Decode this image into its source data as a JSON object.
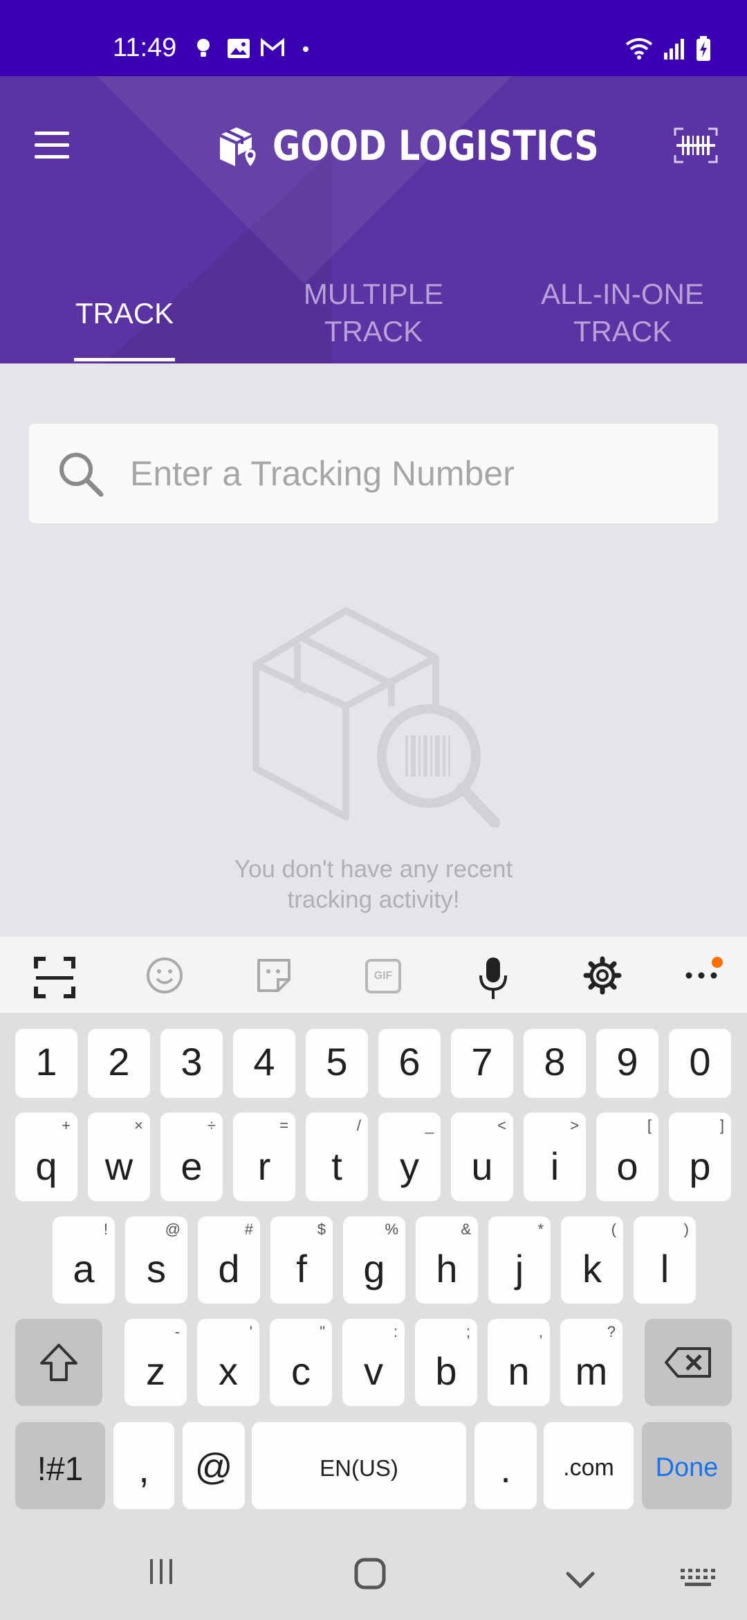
{
  "status_bar": {
    "time": "11:49"
  },
  "app": {
    "title": "GOOD LOGISTICS",
    "tabs": [
      {
        "label": "TRACK",
        "active": true
      },
      {
        "label": "MULTIPLE TRACK",
        "active": false
      },
      {
        "label": "ALL-IN-ONE TRACK",
        "active": false
      }
    ],
    "search": {
      "placeholder": "Enter a Tracking Number",
      "value": ""
    },
    "empty_state": {
      "message": "You don't have any recent tracking activity!"
    }
  },
  "colors": {
    "status_bar": "#3b00b2",
    "header": "#5b33a2",
    "accent_blue": "#1a73e8",
    "notif_dot": "#ff6f00"
  },
  "keyboard": {
    "toolbar_icons": [
      "scan-text-icon",
      "emoji-icon",
      "sticker-icon",
      "gif-icon",
      "microphone-icon",
      "settings-icon",
      "more-icon"
    ],
    "gif_label": "GIF",
    "row_numbers": [
      "1",
      "2",
      "3",
      "4",
      "5",
      "6",
      "7",
      "8",
      "9",
      "0"
    ],
    "row1": [
      {
        "k": "q",
        "s": "+"
      },
      {
        "k": "w",
        "s": "×"
      },
      {
        "k": "e",
        "s": "÷"
      },
      {
        "k": "r",
        "s": "="
      },
      {
        "k": "t",
        "s": "/"
      },
      {
        "k": "y",
        "s": "_"
      },
      {
        "k": "u",
        "s": "<"
      },
      {
        "k": "i",
        "s": ">"
      },
      {
        "k": "o",
        "s": "["
      },
      {
        "k": "p",
        "s": "]"
      }
    ],
    "row2": [
      {
        "k": "a",
        "s": "!"
      },
      {
        "k": "s",
        "s": "@"
      },
      {
        "k": "d",
        "s": "#"
      },
      {
        "k": "f",
        "s": "$"
      },
      {
        "k": "g",
        "s": "%"
      },
      {
        "k": "h",
        "s": "&"
      },
      {
        "k": "j",
        "s": "*"
      },
      {
        "k": "k",
        "s": "("
      },
      {
        "k": "l",
        "s": ")"
      }
    ],
    "row3": [
      {
        "k": "z",
        "s": "-"
      },
      {
        "k": "x",
        "s": "'"
      },
      {
        "k": "c",
        "s": "\""
      },
      {
        "k": "v",
        "s": ":"
      },
      {
        "k": "b",
        "s": ";"
      },
      {
        "k": "n",
        "s": ","
      },
      {
        "k": "m",
        "s": "?"
      }
    ],
    "symbols_label": "!#1",
    "comma_label": ",",
    "at_label": "@",
    "space_label": "EN(US)",
    "period_label": ".",
    "dotcom_label": ".com",
    "done_label": "Done"
  }
}
